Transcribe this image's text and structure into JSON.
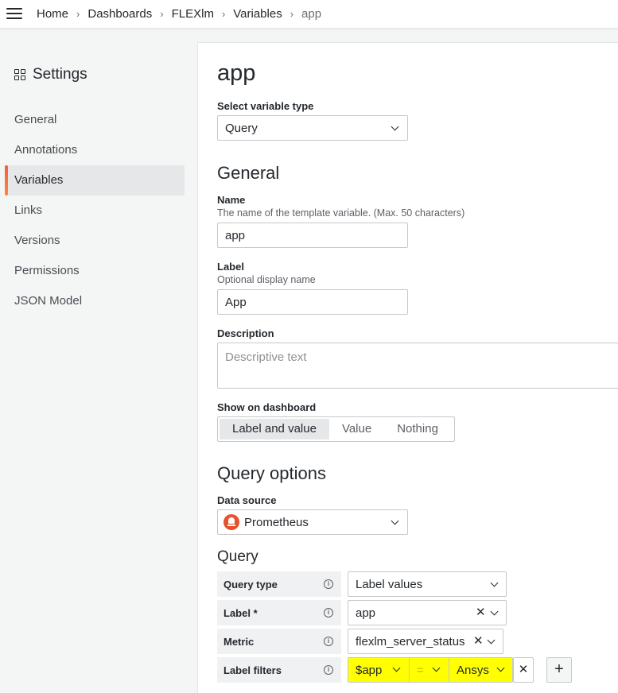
{
  "breadcrumbs": [
    "Home",
    "Dashboards",
    "FLEXlm",
    "Variables",
    "app"
  ],
  "sidebar": {
    "title": "Settings",
    "items": [
      {
        "label": "General"
      },
      {
        "label": "Annotations"
      },
      {
        "label": "Variables",
        "active": true
      },
      {
        "label": "Links"
      },
      {
        "label": "Versions"
      },
      {
        "label": "Permissions"
      },
      {
        "label": "JSON Model"
      }
    ]
  },
  "main": {
    "title": "app",
    "variable_type": {
      "label": "Select variable type",
      "value": "Query"
    },
    "general": {
      "heading": "General",
      "name": {
        "label": "Name",
        "description": "The name of the template variable. (Max. 50 characters)",
        "value": "app"
      },
      "display_label": {
        "label": "Label",
        "description": "Optional display name",
        "value": "App"
      },
      "description": {
        "label": "Description",
        "placeholder": "Descriptive text"
      },
      "show_on_dashboard": {
        "label": "Show on dashboard",
        "options": [
          "Label and value",
          "Value",
          "Nothing"
        ],
        "selected": "Label and value"
      }
    },
    "query_options": {
      "heading": "Query options",
      "data_source": {
        "label": "Data source",
        "value": "Prometheus",
        "icon": "prometheus-icon"
      },
      "query": {
        "heading": "Query",
        "query_type": {
          "label": "Query type",
          "value": "Label values"
        },
        "label": {
          "label": "Label *",
          "value": "app"
        },
        "metric": {
          "label": "Metric",
          "value": "flexlm_server_status"
        },
        "label_filters": {
          "label": "Label filters",
          "key": "$app",
          "operator": "=",
          "value": "Ansys"
        }
      }
    }
  },
  "colors": {
    "accent": "#f55f3e",
    "highlight": "#ffff00",
    "prometheus": "#e6522c"
  }
}
